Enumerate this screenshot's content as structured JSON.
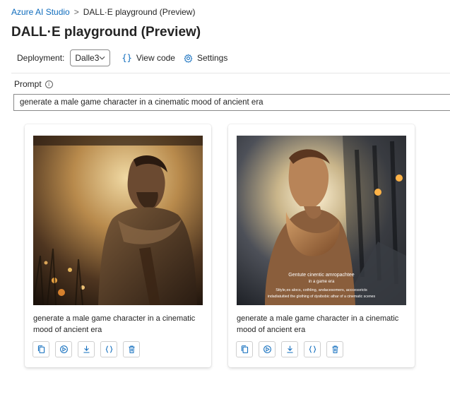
{
  "breadcrumb": {
    "root": "Azure AI Studio",
    "separator": ">",
    "current": "DALL·E playground (Preview)"
  },
  "page_title": "DALL·E playground (Preview)",
  "toolbar": {
    "deployment_label": "Deployment:",
    "deployment_value": "Dalle3",
    "view_code_label": "View code",
    "settings_label": "Settings"
  },
  "prompt": {
    "label": "Prompt",
    "info_icon": "info-icon",
    "value": "generate a male game character in a cinematic mood of ancient era"
  },
  "results": [
    {
      "caption": "generate a male game character in a cinematic mood of ancient era",
      "image_text": []
    },
    {
      "caption": "generate a male game character in a cinematic mood of ancient era",
      "image_text": [
        "Gentute cinentic amropachtee",
        "in a game era",
        "Sttyle,es alocs, cothling, andacesomers, acccessricts",
        "indadiatuitied the glothing of dysibobic athar of a cinematic scenes"
      ]
    }
  ],
  "actions": [
    "copy-icon",
    "regenerate-icon",
    "download-icon",
    "code-icon",
    "delete-icon"
  ],
  "colors": {
    "accent": "#0f6cbd",
    "text": "#242424",
    "border": "#8a8a8a"
  }
}
